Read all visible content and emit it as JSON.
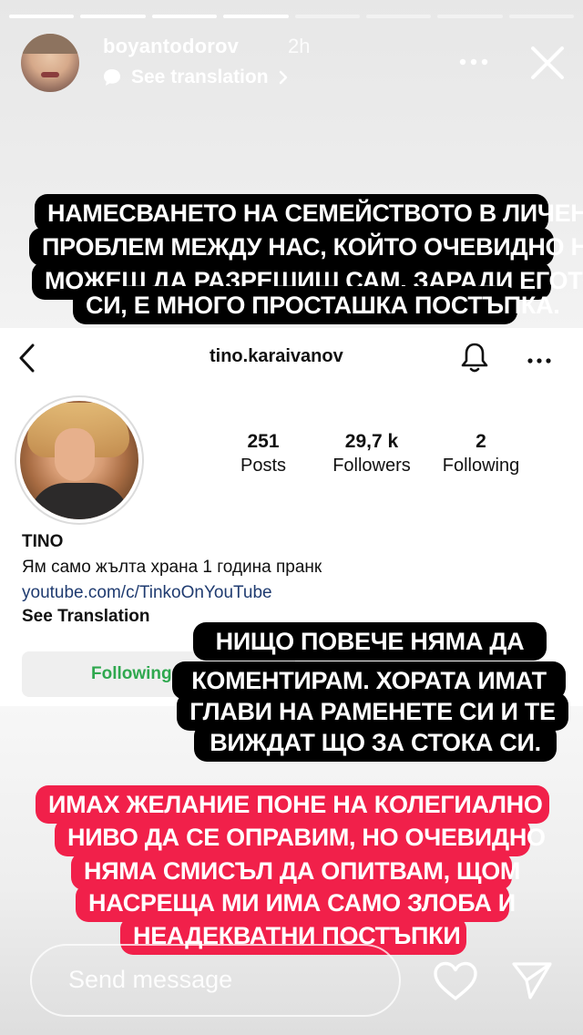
{
  "story": {
    "progress": {
      "total": 8,
      "viewed": 4
    },
    "header": {
      "username": "boyantodorov",
      "time": "2h",
      "translation_link": "See translation"
    },
    "captions": {
      "top": [
        "НАМЕСВАНЕТО НА СЕМЕЙСТВОТО В ЛИЧЕН",
        "ПРОБЛЕМ МЕЖДУ НАС, КОЙТО ОЧЕВИДНО НЕ",
        "МОЖЕШ ДА РАЗРЕШИШ САМ, ЗАРАДИ ЕГОТО",
        "СИ, Е МНОГО ПРОСТАШКА ПОСТЪПКА."
      ],
      "middle": [
        "НИЩО ПОВЕЧЕ НЯМА ДА",
        "КОМЕНТИРАМ. ХОРАТА ИМАТ",
        "ГЛАВИ НА РАМЕНЕТЕ СИ И ТЕ",
        "ВИЖДАТ ЩО ЗА СТОКА СИ."
      ],
      "bottom": [
        "ИМАХ ЖЕЛАНИЕ ПОНЕ НА КОЛЕГИАЛНО",
        "НИВО ДА СЕ ОПРАВИМ, НО ОЧЕВИДНО",
        "НЯМА СМИСЪЛ ДА ОПИТВАМ, ЩОМ",
        "НАСРЕЩА МИ ИМА САМО ЗЛОБА И",
        "НЕАДЕКВАТНИ ПОСТЪПКИ"
      ]
    },
    "profile_screenshot": {
      "username": "tino.karaivanov",
      "stats": [
        {
          "value": "251",
          "label": "Posts"
        },
        {
          "value": "29,7 k",
          "label": "Followers"
        },
        {
          "value": "2",
          "label": "Following"
        }
      ],
      "name": "TINO",
      "bio": "Ям само жълта храна 1 година пранк",
      "link": "youtube.com/c/TinkoOnYouTube",
      "see_translation": "See Translation",
      "follow_button": "Following"
    },
    "footer": {
      "message_placeholder": "Send message"
    },
    "colors": {
      "caption_dark": "#000000",
      "caption_red": "#f1204a",
      "following_green": "#2fa84f",
      "link_blue": "#1f3b70"
    }
  }
}
